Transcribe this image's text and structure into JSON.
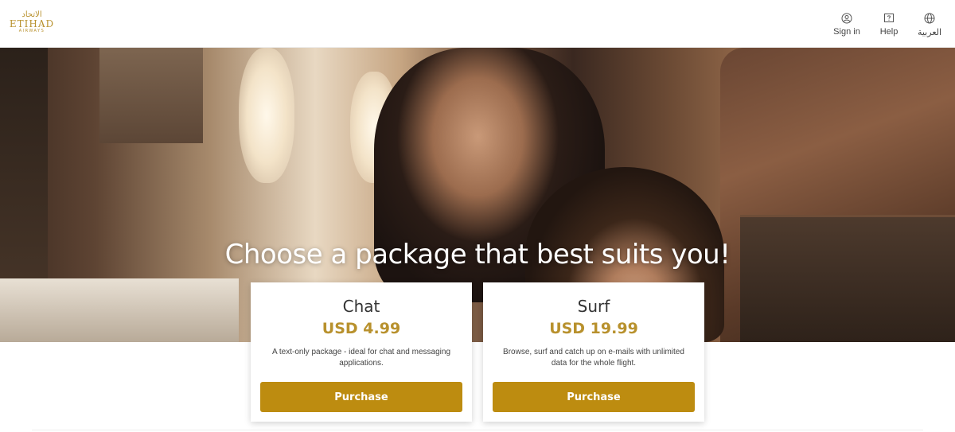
{
  "header": {
    "logo": {
      "arabic": "الاتحاد",
      "main": "ETIHAD",
      "sub": "AIRWAYS"
    },
    "nav": [
      {
        "label": "Sign in",
        "icon": "user-icon"
      },
      {
        "label": "Help",
        "icon": "help-icon"
      },
      {
        "label": "العربية",
        "icon": "globe-icon"
      }
    ]
  },
  "hero": {
    "title": "Choose a package that best suits you!"
  },
  "packages": [
    {
      "name": "Chat",
      "price": "USD 4.99",
      "description": "A text-only package - ideal for chat and messaging applications.",
      "button": "Purchase"
    },
    {
      "name": "Surf",
      "price": "USD 19.99",
      "description": "Browse, surf and catch up on e-mails with unlimited data for the whole flight.",
      "button": "Purchase"
    }
  ],
  "colors": {
    "accent": "#b8912d",
    "button": "#bd8c10"
  }
}
